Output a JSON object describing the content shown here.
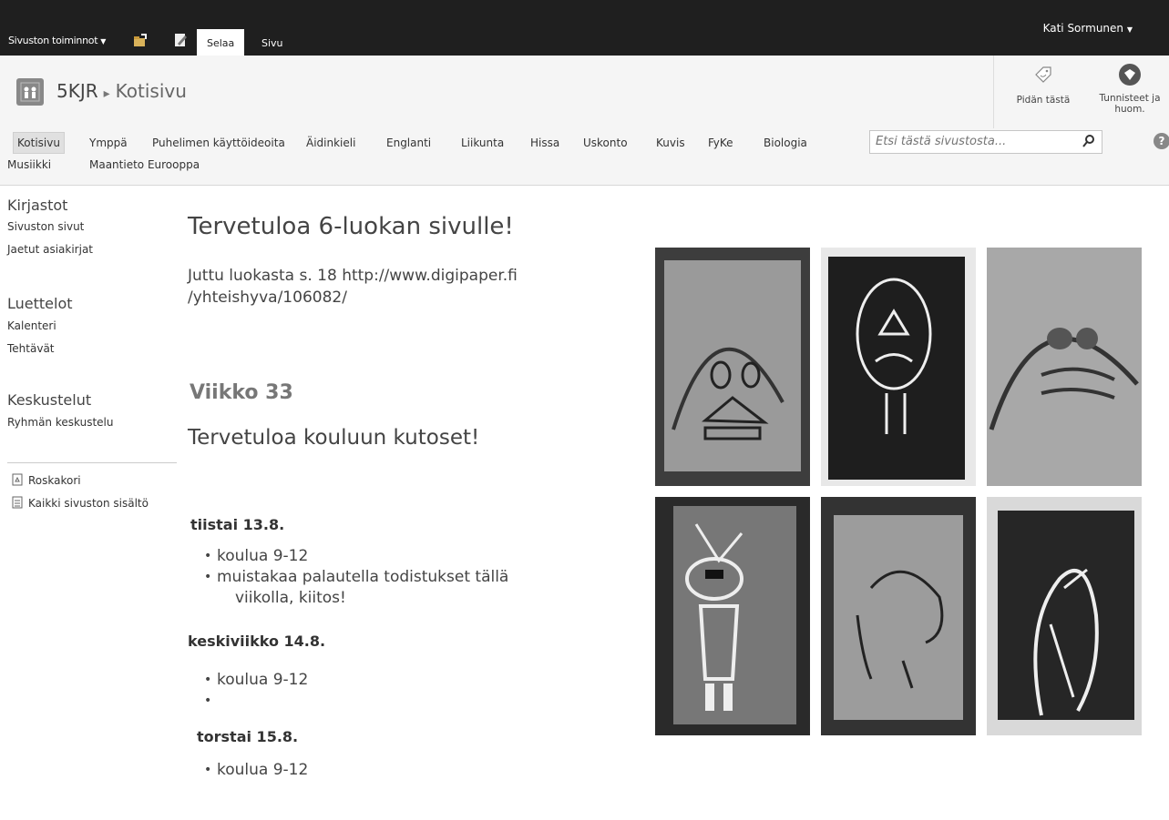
{
  "topbar": {
    "site_actions": "Sivuston toiminnot",
    "tabs": [
      "Selaa",
      "Sivu"
    ],
    "user": "Kati Sormunen"
  },
  "titlearea": {
    "site": "5KJR",
    "page": "Kotisivu",
    "like_label": "Pidän tästä",
    "tags_label_line1": "Tunnisteet ja",
    "tags_label_line2": "huom."
  },
  "topnav": {
    "items": [
      "Kotisivu",
      "Ymppä",
      "Puhelimen käyttöideoita",
      "Äidinkieli",
      "Englanti",
      "Liikunta",
      "Hissa",
      "Uskonto",
      "Kuvis",
      "FyKe",
      "Biologia",
      "Musiikki",
      "Maantieto Eurooppa"
    ],
    "search_placeholder": "Etsi tästä sivustosta...",
    "help": "?"
  },
  "leftnav": {
    "libraries_heading": "Kirjastot",
    "site_pages": "Sivuston sivut",
    "shared_docs": "Jaetut asiakirjat",
    "lists_heading": "Luettelot",
    "calendar": "Kalenteri",
    "tasks": "Tehtävät",
    "discussions_heading": "Keskustelut",
    "team_discussion": "Ryhmän keskustelu",
    "recycle_bin": "Roskakori",
    "all_content": "Kaikki sivuston sisältö"
  },
  "content": {
    "title": "Tervetuloa 6-luokan sivulle!",
    "article_line1": "Juttu luokasta s. 18 http://www.digipaper.fi",
    "article_line2": "/yhteishyva/106082/",
    "week": "Viikko 33",
    "welcome": "Tervetuloa kouluun kutoset!",
    "days": [
      {
        "day": "tiistai 13.8.",
        "items": [
          "koulua 9-12",
          "muistakaa palautella todistukset tällä",
          "viikolla, kiitos!"
        ]
      },
      {
        "day": "keskiviikko 14.8.",
        "items": [
          "koulua 9-12",
          ""
        ]
      },
      {
        "day": "torstai 15.8.",
        "items": [
          "koulua 9-12"
        ]
      }
    ]
  }
}
